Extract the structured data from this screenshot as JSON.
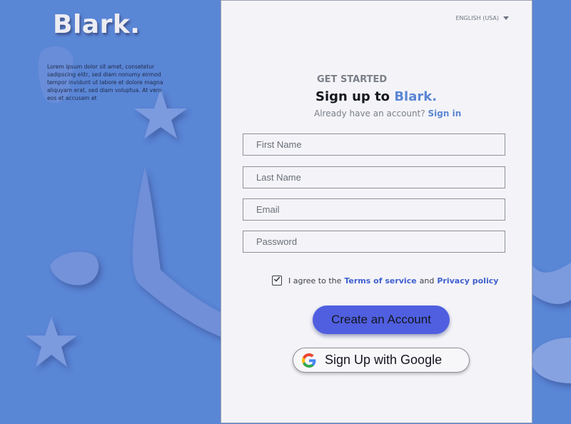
{
  "brand": {
    "name": "Blark."
  },
  "intro": {
    "text": "Lorem ipsum dolor sit amet, consetetur sadipscing elitr, sed diam nonumy eirmod tempor invidunt ut labore et dolore magna aliquyam erat, sed diam voluptua. At vero eos et accusam et"
  },
  "language": {
    "selected": "ENGLISH (USA)"
  },
  "form": {
    "kicker": "GET STARTED",
    "title_prefix": "Sign up to ",
    "title_brand": "Blark.",
    "account_prompt": "Already have an account? ",
    "signin_link": "Sign in",
    "first_name_placeholder": "First Name",
    "last_name_placeholder": "Last Name",
    "email_placeholder": "Email",
    "password_placeholder": "Password",
    "agree_prefix": "I agree to the ",
    "terms_link": "Terms of service",
    "agree_and": " and ",
    "privacy_link": "Privacy policy",
    "agree_checked": true,
    "create_button": "Create an Account",
    "google_button": "Sign Up with Google"
  },
  "colors": {
    "background": "#5a86d6",
    "accent": "#5b86d4",
    "primary_button": "#4f5fe0",
    "panel": "#f4f4f8"
  },
  "icons": [
    "star-icon",
    "caret-down-icon",
    "checkmark-icon",
    "google-logo-icon"
  ]
}
